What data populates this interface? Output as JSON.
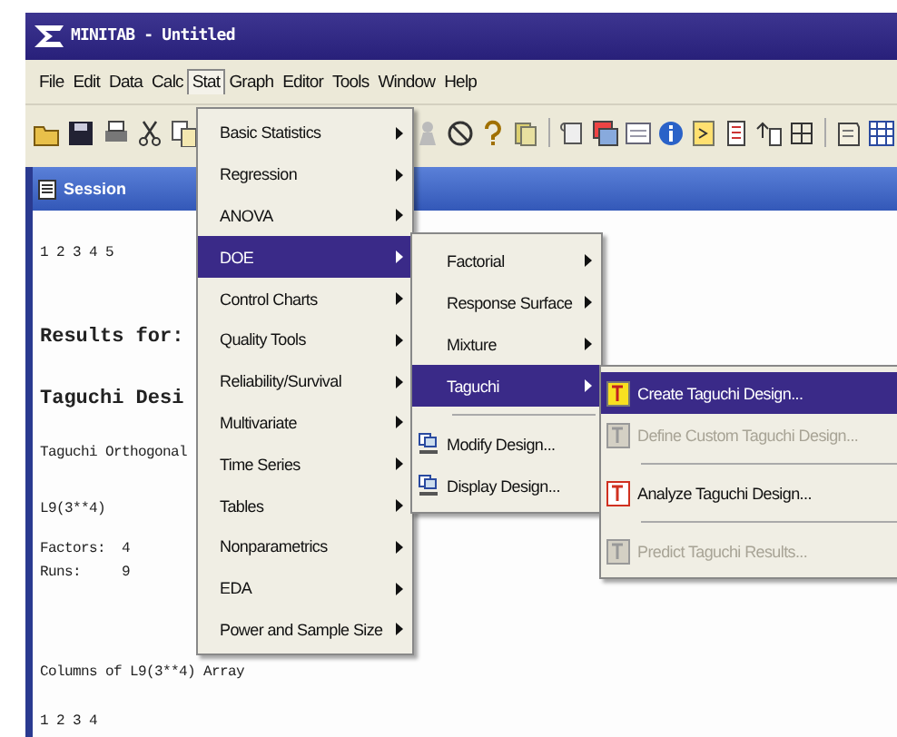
{
  "window": {
    "title": "MINITAB - Untitled"
  },
  "menubar": [
    {
      "label": "File",
      "selected": false
    },
    {
      "label": "Edit",
      "selected": false
    },
    {
      "label": "Data",
      "selected": false
    },
    {
      "label": "Calc",
      "selected": false
    },
    {
      "label": "Stat",
      "selected": true
    },
    {
      "label": "Graph",
      "selected": false
    },
    {
      "label": "Editor",
      "selected": false
    },
    {
      "label": "Tools",
      "selected": false
    },
    {
      "label": "Window",
      "selected": false
    },
    {
      "label": "Help",
      "selected": false
    }
  ],
  "session": {
    "title": "Session",
    "lines": [
      {
        "kind": "text",
        "text": "1 2 3 4 5"
      },
      {
        "kind": "heading",
        "text": "Results for:"
      },
      {
        "kind": "heading",
        "text": "Taguchi Desi"
      },
      {
        "kind": "text",
        "text": "Taguchi Orthogonal"
      },
      {
        "kind": "text",
        "text": "L9(3**4)"
      },
      {
        "kind": "tight",
        "text": "Factors:  4"
      },
      {
        "kind": "text",
        "text": "Runs:     9"
      },
      {
        "kind": "gap",
        "text": "Columns of L9(3**4) Array"
      },
      {
        "kind": "text",
        "text": "1 2 3 4"
      }
    ]
  },
  "stat_menu": [
    {
      "label": "Basic Statistics",
      "selected": false
    },
    {
      "label": "Regression",
      "selected": false
    },
    {
      "label": "ANOVA",
      "selected": false
    },
    {
      "label": "DOE",
      "selected": true
    },
    {
      "label": "Control Charts",
      "selected": false
    },
    {
      "label": "Quality Tools",
      "selected": false
    },
    {
      "label": "Reliability/Survival",
      "selected": false
    },
    {
      "label": "Multivariate",
      "selected": false
    },
    {
      "label": "Time Series",
      "selected": false
    },
    {
      "label": "Tables",
      "selected": false
    },
    {
      "label": "Nonparametrics",
      "selected": false
    },
    {
      "label": "EDA",
      "selected": false
    },
    {
      "label": "Power and Sample Size",
      "selected": false
    }
  ],
  "doe_menu": [
    {
      "kind": "submenu",
      "label": "Factorial",
      "selected": false
    },
    {
      "kind": "submenu",
      "label": "Response Surface",
      "selected": false
    },
    {
      "kind": "submenu",
      "label": "Mixture",
      "selected": false
    },
    {
      "kind": "submenu",
      "label": "Taguchi",
      "selected": true
    },
    {
      "kind": "separator"
    },
    {
      "kind": "command",
      "label": "Modify Design...",
      "selected": false
    },
    {
      "kind": "command",
      "label": "Display Design...",
      "selected": false
    }
  ],
  "taguchi_menu": [
    {
      "kind": "command",
      "label": "Create Taguchi Design...",
      "selected": true,
      "disabled": false
    },
    {
      "kind": "command",
      "label": "Define Custom Taguchi Design...",
      "selected": false,
      "disabled": true
    },
    {
      "kind": "separator"
    },
    {
      "kind": "command",
      "label": "Analyze Taguchi Design...",
      "selected": false,
      "disabled": false
    },
    {
      "kind": "separator"
    },
    {
      "kind": "command",
      "label": "Predict Taguchi Results...",
      "selected": false,
      "disabled": true
    }
  ]
}
